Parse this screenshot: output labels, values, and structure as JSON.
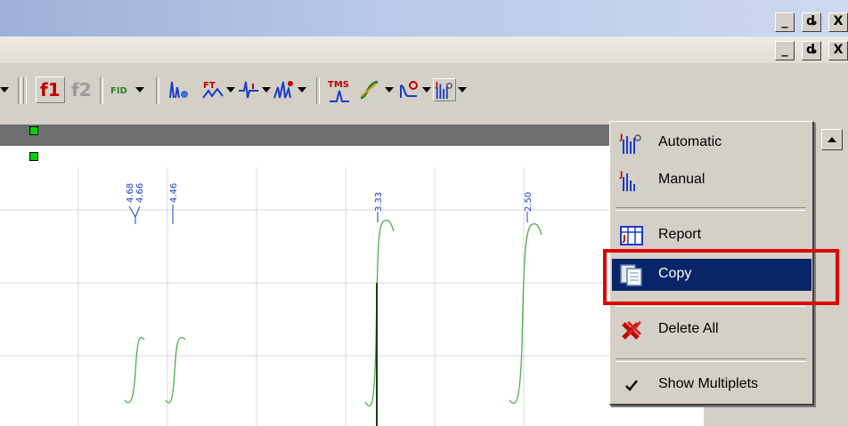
{
  "window": {
    "controls_top": [
      "_",
      "ȡ",
      "X"
    ],
    "controls_second": [
      "_",
      "ȡ",
      "X"
    ]
  },
  "toolbar": {
    "f1_label": "f1",
    "f2_label": "f2",
    "fid_label": "FID",
    "tms_label": "TMS"
  },
  "peaks": {
    "labels": [
      "4.68",
      "4.66",
      "4.46",
      "3.33",
      "2.50"
    ]
  },
  "context_menu": {
    "items": [
      {
        "label": "Automatic",
        "icon": "multiplet-auto-icon"
      },
      {
        "label": "Manual",
        "icon": "multiplet-manual-icon"
      },
      {
        "label": "Report",
        "icon": "report-icon"
      },
      {
        "label": "Copy",
        "icon": "copy-icon",
        "selected": true
      },
      {
        "label": "Delete All",
        "icon": "delete-all-icon"
      },
      {
        "label": "Show Multiplets",
        "icon": "checkmark-icon",
        "checked": true
      }
    ]
  },
  "colors": {
    "selection": "#0a246a",
    "highlight_box": "#e00000",
    "spectrum_line": "#4caf50"
  }
}
